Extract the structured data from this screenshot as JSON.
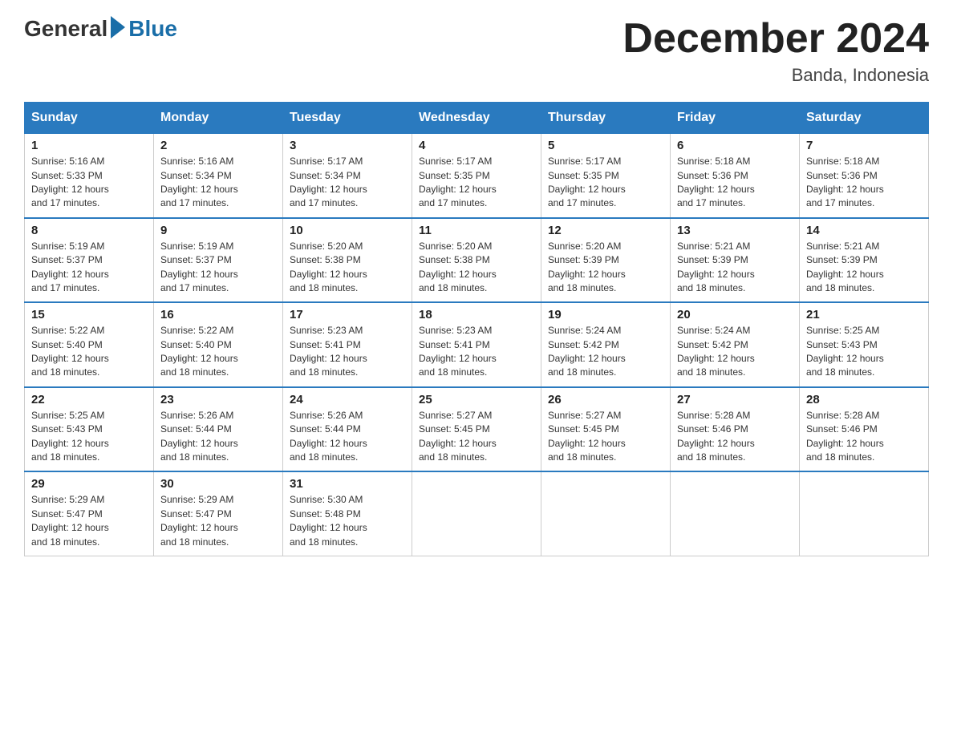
{
  "logo": {
    "general": "General",
    "blue": "Blue"
  },
  "header": {
    "month": "December 2024",
    "location": "Banda, Indonesia"
  },
  "days_of_week": [
    "Sunday",
    "Monday",
    "Tuesday",
    "Wednesday",
    "Thursday",
    "Friday",
    "Saturday"
  ],
  "weeks": [
    [
      {
        "day": "1",
        "sunrise": "5:16 AM",
        "sunset": "5:33 PM",
        "daylight": "12 hours and 17 minutes."
      },
      {
        "day": "2",
        "sunrise": "5:16 AM",
        "sunset": "5:34 PM",
        "daylight": "12 hours and 17 minutes."
      },
      {
        "day": "3",
        "sunrise": "5:17 AM",
        "sunset": "5:34 PM",
        "daylight": "12 hours and 17 minutes."
      },
      {
        "day": "4",
        "sunrise": "5:17 AM",
        "sunset": "5:35 PM",
        "daylight": "12 hours and 17 minutes."
      },
      {
        "day": "5",
        "sunrise": "5:17 AM",
        "sunset": "5:35 PM",
        "daylight": "12 hours and 17 minutes."
      },
      {
        "day": "6",
        "sunrise": "5:18 AM",
        "sunset": "5:36 PM",
        "daylight": "12 hours and 17 minutes."
      },
      {
        "day": "7",
        "sunrise": "5:18 AM",
        "sunset": "5:36 PM",
        "daylight": "12 hours and 17 minutes."
      }
    ],
    [
      {
        "day": "8",
        "sunrise": "5:19 AM",
        "sunset": "5:37 PM",
        "daylight": "12 hours and 17 minutes."
      },
      {
        "day": "9",
        "sunrise": "5:19 AM",
        "sunset": "5:37 PM",
        "daylight": "12 hours and 17 minutes."
      },
      {
        "day": "10",
        "sunrise": "5:20 AM",
        "sunset": "5:38 PM",
        "daylight": "12 hours and 18 minutes."
      },
      {
        "day": "11",
        "sunrise": "5:20 AM",
        "sunset": "5:38 PM",
        "daylight": "12 hours and 18 minutes."
      },
      {
        "day": "12",
        "sunrise": "5:20 AM",
        "sunset": "5:39 PM",
        "daylight": "12 hours and 18 minutes."
      },
      {
        "day": "13",
        "sunrise": "5:21 AM",
        "sunset": "5:39 PM",
        "daylight": "12 hours and 18 minutes."
      },
      {
        "day": "14",
        "sunrise": "5:21 AM",
        "sunset": "5:39 PM",
        "daylight": "12 hours and 18 minutes."
      }
    ],
    [
      {
        "day": "15",
        "sunrise": "5:22 AM",
        "sunset": "5:40 PM",
        "daylight": "12 hours and 18 minutes."
      },
      {
        "day": "16",
        "sunrise": "5:22 AM",
        "sunset": "5:40 PM",
        "daylight": "12 hours and 18 minutes."
      },
      {
        "day": "17",
        "sunrise": "5:23 AM",
        "sunset": "5:41 PM",
        "daylight": "12 hours and 18 minutes."
      },
      {
        "day": "18",
        "sunrise": "5:23 AM",
        "sunset": "5:41 PM",
        "daylight": "12 hours and 18 minutes."
      },
      {
        "day": "19",
        "sunrise": "5:24 AM",
        "sunset": "5:42 PM",
        "daylight": "12 hours and 18 minutes."
      },
      {
        "day": "20",
        "sunrise": "5:24 AM",
        "sunset": "5:42 PM",
        "daylight": "12 hours and 18 minutes."
      },
      {
        "day": "21",
        "sunrise": "5:25 AM",
        "sunset": "5:43 PM",
        "daylight": "12 hours and 18 minutes."
      }
    ],
    [
      {
        "day": "22",
        "sunrise": "5:25 AM",
        "sunset": "5:43 PM",
        "daylight": "12 hours and 18 minutes."
      },
      {
        "day": "23",
        "sunrise": "5:26 AM",
        "sunset": "5:44 PM",
        "daylight": "12 hours and 18 minutes."
      },
      {
        "day": "24",
        "sunrise": "5:26 AM",
        "sunset": "5:44 PM",
        "daylight": "12 hours and 18 minutes."
      },
      {
        "day": "25",
        "sunrise": "5:27 AM",
        "sunset": "5:45 PM",
        "daylight": "12 hours and 18 minutes."
      },
      {
        "day": "26",
        "sunrise": "5:27 AM",
        "sunset": "5:45 PM",
        "daylight": "12 hours and 18 minutes."
      },
      {
        "day": "27",
        "sunrise": "5:28 AM",
        "sunset": "5:46 PM",
        "daylight": "12 hours and 18 minutes."
      },
      {
        "day": "28",
        "sunrise": "5:28 AM",
        "sunset": "5:46 PM",
        "daylight": "12 hours and 18 minutes."
      }
    ],
    [
      {
        "day": "29",
        "sunrise": "5:29 AM",
        "sunset": "5:47 PM",
        "daylight": "12 hours and 18 minutes."
      },
      {
        "day": "30",
        "sunrise": "5:29 AM",
        "sunset": "5:47 PM",
        "daylight": "12 hours and 18 minutes."
      },
      {
        "day": "31",
        "sunrise": "5:30 AM",
        "sunset": "5:48 PM",
        "daylight": "12 hours and 18 minutes."
      },
      null,
      null,
      null,
      null
    ]
  ],
  "labels": {
    "sunrise": "Sunrise:",
    "sunset": "Sunset:",
    "daylight": "Daylight:"
  }
}
